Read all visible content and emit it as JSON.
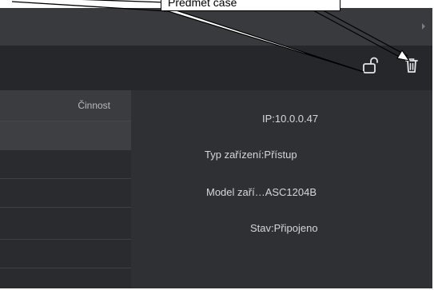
{
  "callout": {
    "text": "Předmět case"
  },
  "toolbar": {
    "icons": [
      "lock-open-icon",
      "trash-icon"
    ]
  },
  "list": {
    "column_header": "Činnost",
    "rows": [
      "",
      "",
      "",
      "",
      ""
    ],
    "selected_index": 0
  },
  "details": {
    "ip": "IP:10.0.0.47",
    "device_type": "Typ zařízení:Přístup",
    "device_model": "Model zaří…ASC1204B",
    "status": "Stav:Připojeno"
  },
  "colors": {
    "background": "#2f3034",
    "toolbar": "#26272a",
    "text": "#d6d7d9",
    "callout_border": "#000000"
  }
}
